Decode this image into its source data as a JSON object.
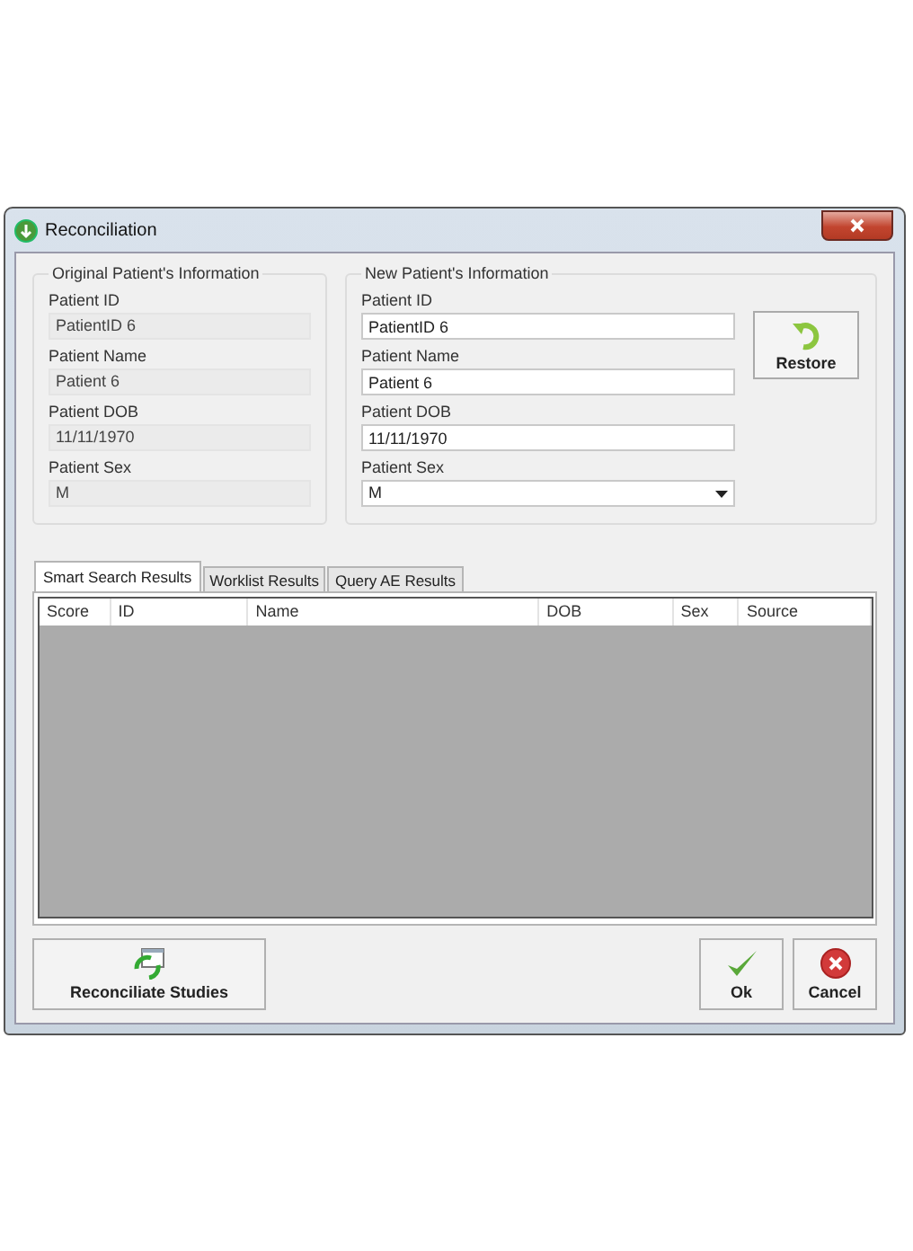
{
  "window": {
    "title": "Reconciliation"
  },
  "original": {
    "title": "Original Patient's Information",
    "fields": [
      {
        "label": "Patient ID",
        "value": "PatientID 6"
      },
      {
        "label": "Patient Name",
        "value": "Patient 6"
      },
      {
        "label": "Patient DOB",
        "value": "11/11/1970"
      },
      {
        "label": "Patient Sex",
        "value": "M"
      }
    ]
  },
  "new": {
    "title": "New Patient's Information",
    "fields": [
      {
        "label": "Patient ID",
        "value": "PatientID 6",
        "kind": "text"
      },
      {
        "label": "Patient Name",
        "value": "Patient 6",
        "kind": "text"
      },
      {
        "label": "Patient DOB",
        "value": "11/11/1970",
        "kind": "text"
      },
      {
        "label": "Patient Sex",
        "value": "M",
        "kind": "dropdown"
      }
    ]
  },
  "restore_button": {
    "label": "Restore"
  },
  "tabs": [
    {
      "label": "Smart Search Results",
      "selected": true
    },
    {
      "label": "Worklist Results",
      "selected": false
    },
    {
      "label": "Query AE Results",
      "selected": false
    }
  ],
  "table": {
    "columns": [
      "Score",
      "ID",
      "Name",
      "DOB",
      "Sex",
      "Source"
    ]
  },
  "buttons": [
    {
      "label": "Reconciliate Studies",
      "kind": "reconcile"
    },
    {
      "label": "Ok",
      "kind": "ok"
    },
    {
      "label": "Cancel",
      "kind": "cancel"
    }
  ]
}
